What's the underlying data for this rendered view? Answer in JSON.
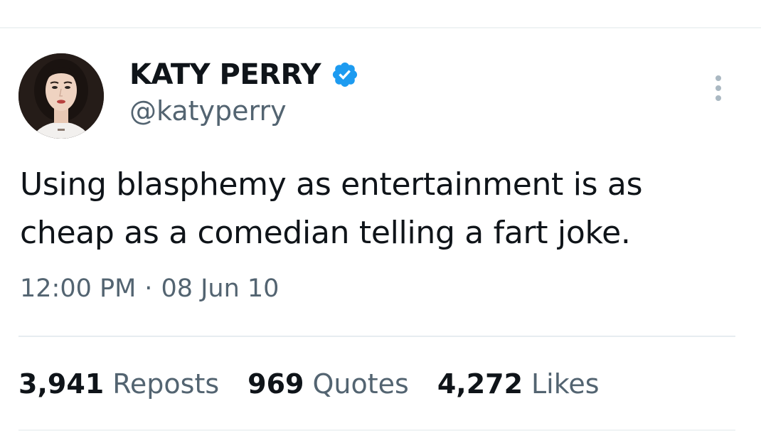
{
  "author": {
    "display_name": "KATY PERRY",
    "handle": "@katyperry",
    "verified_icon": "verified-badge-icon",
    "verified_color": "#1d9bf0"
  },
  "tweet": {
    "text": "Using blasphemy as entertainment is as cheap as a comedian telling a fart joke.",
    "time": "12:00 PM",
    "separator": "·",
    "date": "08 Jun 10"
  },
  "stats": [
    {
      "count": "3,941",
      "label": "Reposts"
    },
    {
      "count": "969",
      "label": "Quotes"
    },
    {
      "count": "4,272",
      "label": "Likes"
    }
  ],
  "icons": {
    "more": "more-vertical-icon"
  },
  "colors": {
    "text_primary": "#0f1419",
    "text_secondary": "#536471",
    "divider": "#eff3f4"
  }
}
